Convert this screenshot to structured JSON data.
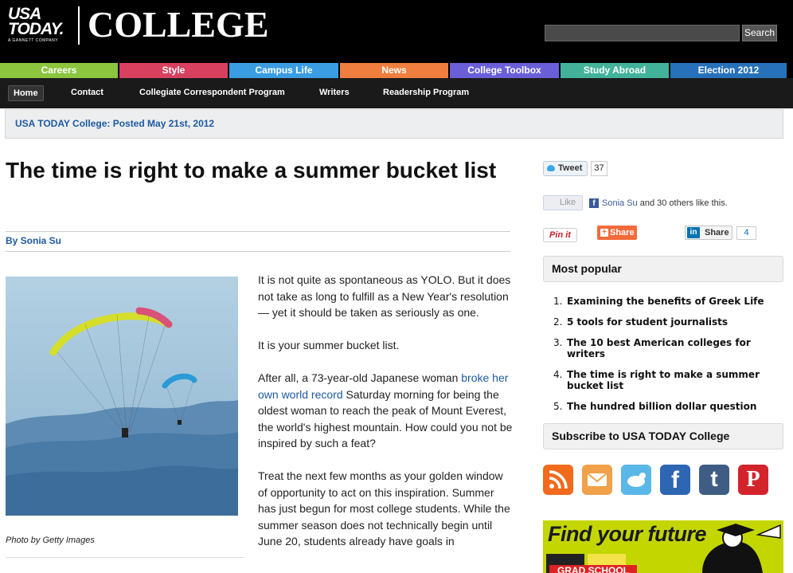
{
  "brand": {
    "usa_today_line1": "USA",
    "usa_today_line2": "TODAY.",
    "gannett": "A GANNETT COMPANY",
    "section": "COLLEGE"
  },
  "search": {
    "button": "Search",
    "placeholder": ""
  },
  "category_nav": [
    {
      "label": "Careers",
      "color": "#8cc63e"
    },
    {
      "label": "Style",
      "color": "#d8405f"
    },
    {
      "label": "Campus Life",
      "color": "#3a9de2"
    },
    {
      "label": "News",
      "color": "#f07e3e"
    },
    {
      "label": "College Toolbox",
      "color": "#6a5fd8"
    },
    {
      "label": "Study Abroad",
      "color": "#42b39a"
    },
    {
      "label": "Election 2012",
      "color": "#2671b9"
    }
  ],
  "sub_nav": [
    "Home",
    "Contact",
    "Collegiate Correspondent Program",
    "Writers",
    "Readership Program"
  ],
  "breadcrumb": "USA TODAY College: Posted May 21st, 2012",
  "article": {
    "title": "The time is right to make a summer bucket list",
    "byline": "By Sonia Su",
    "caption": "Photo by Getty Images",
    "p1": "It is not quite as spontaneous as YOLO. But it does not take as long to fulfill as a New Year's resolution — yet it should be taken as seriously as one.",
    "p2": "It is your summer bucket list.",
    "p3_a": "After all, a 73-year-old Japanese woman ",
    "p3_link": "broke her own world record",
    "p3_b": " Saturday morning for being the oldest woman to reach the peak of Mount Everest, the world's highest mountain. How could you not be inspired by such a feat?",
    "p4": "Treat the next few months as your golden window of opportunity to act on this inspiration. Summer has just begun for most college students. While the summer season does not technically begin until June 20, students already have goals in"
  },
  "social_share": {
    "tweet": "Tweet",
    "tweet_count": "37",
    "like": "Like",
    "like_name": "Sonia Su",
    "like_rest": " and 30 others like this.",
    "pinit": "Pin it",
    "share": "Share",
    "linkedin_share": "Share",
    "linkedin_count": "4"
  },
  "most_popular": {
    "heading": "Most popular",
    "items": [
      "Examining the benefits of Greek Life",
      "5 tools for student journalists",
      "The 10 best American colleges for writers",
      "The time is right to make a summer bucket list",
      "The hundred billion dollar question"
    ]
  },
  "subscribe": {
    "heading": "Subscribe to USA TODAY College",
    "icons": [
      {
        "name": "rss-icon",
        "color": "#f26a1b"
      },
      {
        "name": "email-icon",
        "color": "#f0a14a"
      },
      {
        "name": "twitter-icon",
        "color": "#5ab8e8"
      },
      {
        "name": "facebook-icon",
        "color": "#2d66b2"
      },
      {
        "name": "tumblr-icon",
        "color": "#3f5d84"
      },
      {
        "name": "pinterest-icon",
        "color": "#d3242c"
      }
    ]
  },
  "ad": {
    "headline": "Find your future",
    "badge": "GRAD SCHOOL"
  }
}
